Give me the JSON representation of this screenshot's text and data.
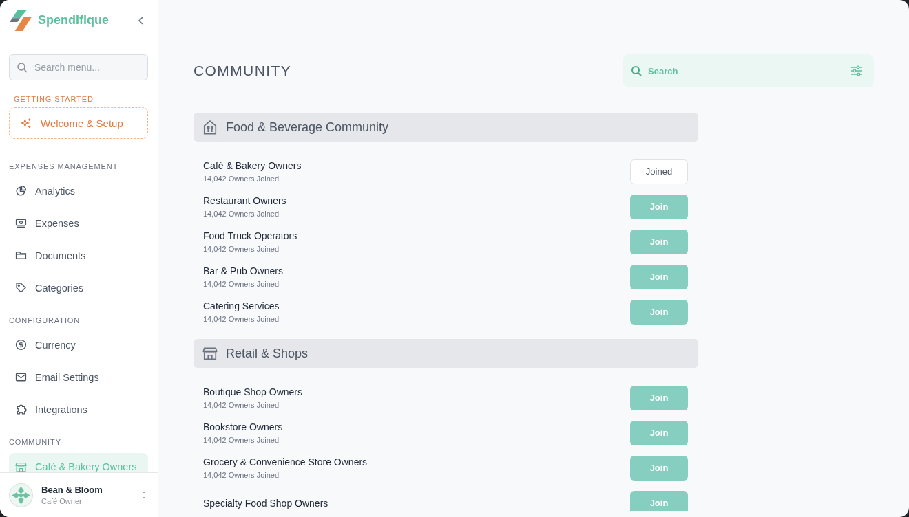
{
  "brand": {
    "name": "Spendifique"
  },
  "sidebar": {
    "search": {
      "placeholder": "Search menu..."
    },
    "sections": [
      {
        "title": "GETTING STARTED",
        "kind": "setup",
        "items": [
          {
            "label": "Welcome & Setup",
            "selected": false
          }
        ]
      },
      {
        "title": "EXPENSES MANAGEMENT",
        "kind": "nav",
        "items": [
          {
            "label": "Analytics",
            "selected": false
          },
          {
            "label": "Expenses",
            "selected": false
          },
          {
            "label": "Documents",
            "selected": false
          },
          {
            "label": "Categories",
            "selected": false
          }
        ]
      },
      {
        "title": "CONFIGURATION",
        "kind": "nav",
        "items": [
          {
            "label": "Currency",
            "selected": false
          },
          {
            "label": "Email Settings",
            "selected": false
          },
          {
            "label": "Integrations",
            "selected": false
          }
        ]
      },
      {
        "title": "COMMUNITY",
        "kind": "nav",
        "items": [
          {
            "label": "Café & Bakery Owners",
            "selected": true
          }
        ]
      }
    ],
    "user": {
      "name": "Bean & Bloom",
      "role": "Café Owner"
    }
  },
  "page": {
    "title": "COMMUNITY",
    "search": {
      "placeholder": "Search"
    }
  },
  "groups": [
    {
      "title": "Food & Beverage Community",
      "rows": [
        {
          "name": "Café & Bakery Owners",
          "members": "14,042 Owners Joined",
          "button": "Joined",
          "joined": true
        },
        {
          "name": "Restaurant Owners",
          "members": "14,042 Owners Joined",
          "button": "Join",
          "joined": false
        },
        {
          "name": "Food Truck Operators",
          "members": "14,042 Owners Joined",
          "button": "Join",
          "joined": false
        },
        {
          "name": "Bar & Pub Owners",
          "members": "14,042 Owners Joined",
          "button": "Join",
          "joined": false
        },
        {
          "name": "Catering Services",
          "members": "14,042 Owners Joined",
          "button": "Join",
          "joined": false
        }
      ]
    },
    {
      "title": "Retail & Shops",
      "rows": [
        {
          "name": "Boutique Shop Owners",
          "members": "14,042 Owners Joined",
          "button": "Join",
          "joined": false
        },
        {
          "name": "Bookstore Owners",
          "members": "14,042 Owners Joined",
          "button": "Join",
          "joined": false
        },
        {
          "name": "Grocery & Convenience Store Owners",
          "members": "14,042 Owners Joined",
          "button": "Join",
          "joined": false
        },
        {
          "name": "Specialty Food Shop Owners",
          "button": "Join",
          "joined": false
        }
      ]
    }
  ]
}
